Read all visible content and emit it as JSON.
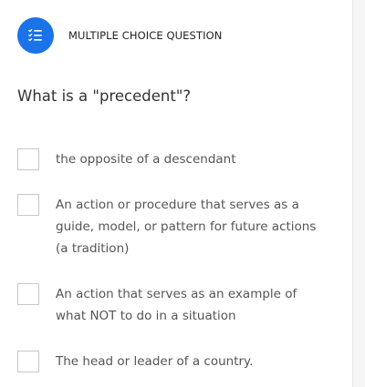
{
  "header": {
    "type_label": "MULTIPLE CHOICE QUESTION",
    "icon": "list-check-icon",
    "accent_color": "#1a73e8"
  },
  "question": {
    "text": "What is a \"precedent\"?"
  },
  "options": [
    {
      "label": "the opposite of a descendant"
    },
    {
      "label": "An action or procedure that serves as a guide, model, or pattern for future actions (a tradition)"
    },
    {
      "label": "An action that serves as an example of what NOT to do in a situation"
    },
    {
      "label": "The head or leader of a country."
    }
  ]
}
